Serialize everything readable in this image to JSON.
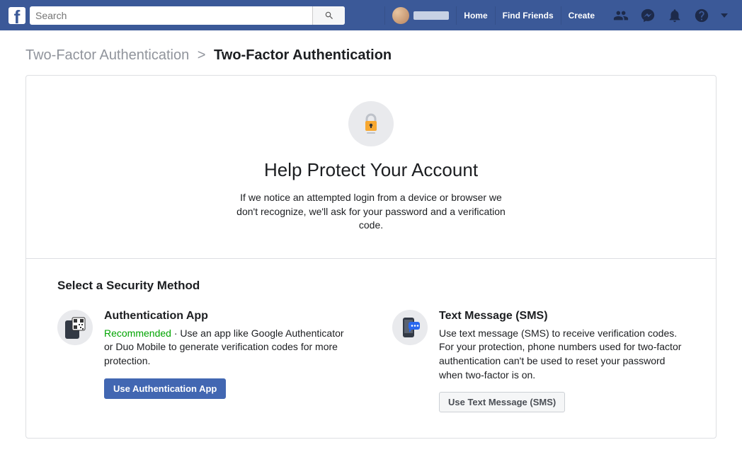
{
  "nav": {
    "search_placeholder": "Search",
    "links": [
      "Home",
      "Find Friends",
      "Create"
    ]
  },
  "breadcrumb": {
    "parent": "Two-Factor Authentication",
    "separator": ">",
    "current": "Two-Factor Authentication"
  },
  "hero": {
    "title": "Help Protect Your Account",
    "description": "If we notice an attempted login from a device or browser we don't recognize, we'll ask for your password and a verification code."
  },
  "section": {
    "title": "Select a Security Method"
  },
  "methods": {
    "app": {
      "title": "Authentication App",
      "recommended": "Recommended",
      "desc_sep": " · ",
      "description": "Use an app like Google Authenticator or Duo Mobile to generate verification codes for more protection.",
      "button": "Use Authentication App"
    },
    "sms": {
      "title": "Text Message (SMS)",
      "description": "Use text message (SMS) to receive verification codes. For your protection, phone numbers used for two-factor authentication can't be used to reset your password when two-factor is on.",
      "button": "Use Text Message (SMS)"
    }
  }
}
